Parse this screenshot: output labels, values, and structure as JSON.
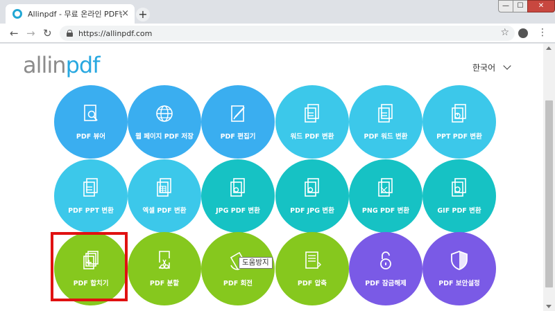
{
  "browser": {
    "tab_title": "Allinpdf - 무료 온라인 PDF변환",
    "tab_close": "×",
    "new_tab": "+",
    "url": "https://allinpdf.com",
    "min": "—",
    "max": "☐",
    "close": "✕",
    "back": "←",
    "forward": "→",
    "reload": "↻",
    "star": "☆",
    "menu": "⋮"
  },
  "header": {
    "logo_part1": "allin",
    "logo_part2": "pdf",
    "language": "한국어"
  },
  "colors": {
    "blue": "#3aaef0",
    "cyan": "#3cc8ea",
    "teal": "#16c2c4",
    "green": "#86c81e",
    "purple": "#7a5ae6"
  },
  "tools": [
    {
      "label": "PDF 뷰어",
      "icon": "magnifier-doc-icon"
    },
    {
      "label": "웹 페이지 PDF 저장",
      "icon": "globe-icon"
    },
    {
      "label": "PDF 편집기",
      "icon": "pencil-doc-icon"
    },
    {
      "label": "워드 PDF 변환",
      "icon": "doc-icon"
    },
    {
      "label": "PDF 워드 변환",
      "icon": "doc-icon"
    },
    {
      "label": "PPT PDF 변환",
      "icon": "chart-doc-icon"
    },
    {
      "label": "PDF PPT 변환",
      "icon": "doc-icon"
    },
    {
      "label": "엑셀 PDF 변환",
      "icon": "sheet-doc-icon"
    },
    {
      "label": "JPG PDF 변환",
      "icon": "image-doc-icon"
    },
    {
      "label": "PDF JPG 변환",
      "icon": "image-doc-icon"
    },
    {
      "label": "PNG PDF 변환",
      "icon": "grid-doc-icon"
    },
    {
      "label": "GIF PDF 변환",
      "icon": "gif-doc-icon"
    },
    {
      "label": "PDF 합치기",
      "icon": "merge-doc-icon"
    },
    {
      "label": "PDF 분할",
      "icon": "scissors-doc-icon"
    },
    {
      "label": "PDF 회전",
      "icon": "rotate-doc-icon"
    },
    {
      "label": "PDF 압축",
      "icon": "compress-doc-icon"
    },
    {
      "label": "PDF 잠금해제",
      "icon": "unlock-icon"
    },
    {
      "label": "PDF 보안설정",
      "icon": "shield-icon"
    }
  ],
  "tooltip": "도움방지"
}
